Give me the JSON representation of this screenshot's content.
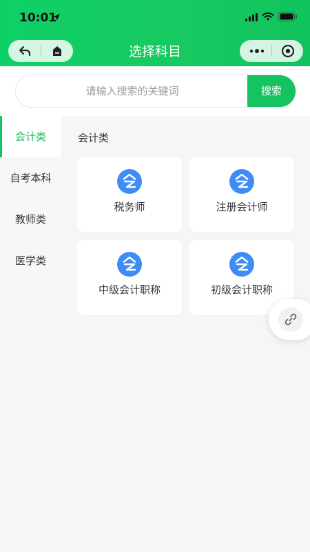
{
  "status_bar": {
    "time": "10:01"
  },
  "nav": {
    "title": "选择科目"
  },
  "search": {
    "placeholder": "请输入搜索的关键词",
    "button_label": "搜索"
  },
  "sidebar": {
    "items": [
      {
        "label": "会计类",
        "active": true
      },
      {
        "label": "自考本科",
        "active": false
      },
      {
        "label": "教师类",
        "active": false
      },
      {
        "label": "医学类",
        "active": false
      }
    ]
  },
  "main": {
    "section_title": "会计类",
    "cards": [
      {
        "label": "税务师",
        "icon": "subject-logo-icon"
      },
      {
        "label": "注册会计师",
        "icon": "subject-logo-icon"
      },
      {
        "label": "中级会计职称",
        "icon": "subject-logo-icon"
      },
      {
        "label": "初级会计职称",
        "icon": "subject-logo-icon"
      }
    ]
  },
  "floating": {
    "icon": "link-icon"
  },
  "colors": {
    "brand_green": "#15c460",
    "active_text": "#15b85a",
    "icon_blue": "#3d8df5"
  }
}
